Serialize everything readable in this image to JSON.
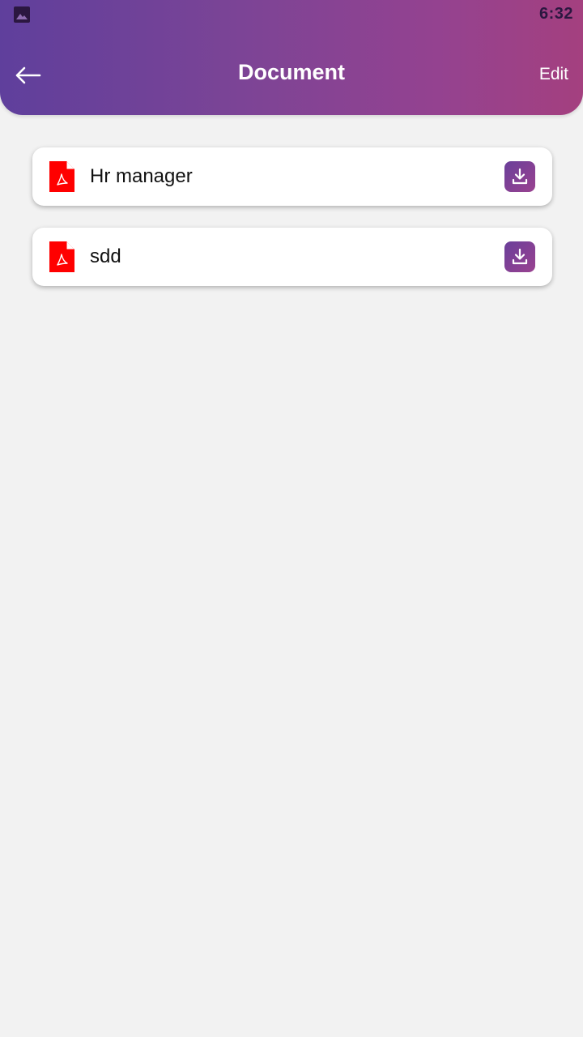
{
  "status_bar": {
    "time": "6:32",
    "notification_icon": "gallery-icon"
  },
  "header": {
    "title": "Document",
    "back_icon": "arrow-left-icon",
    "edit_label": "Edit"
  },
  "documents": [
    {
      "name": "Hr manager",
      "type_icon": "pdf-icon",
      "action_icon": "download-icon"
    },
    {
      "name": "sdd",
      "type_icon": "pdf-icon",
      "action_icon": "download-icon"
    }
  ],
  "colors": {
    "header_gradient_start": "#5f3f9c",
    "header_gradient_end": "#a4407f",
    "pdf_red": "#ff0000",
    "background": "#f2f2f2"
  }
}
